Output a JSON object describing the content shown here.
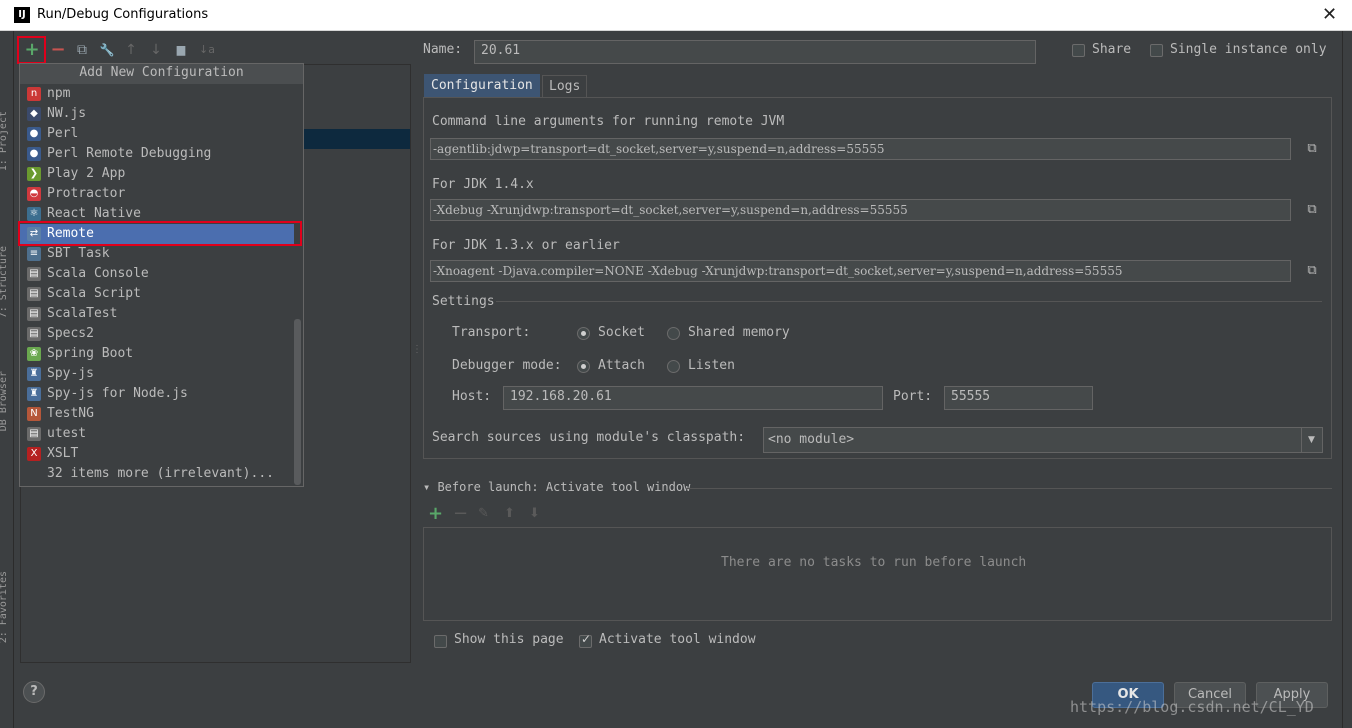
{
  "window": {
    "title": "Run/Debug Configurations",
    "app_badge": "IJ",
    "close_glyph": "✕"
  },
  "left_strip": [
    "1: Project",
    "7: Structure",
    "DB Browser",
    "2: Favorites"
  ],
  "toolbar": {
    "add": "+",
    "remove": "−",
    "copy": "⧉",
    "edit_defaults": "🔧",
    "move_up": "↑",
    "move_down": "↓",
    "folder": "▆",
    "sort": "↓a"
  },
  "popup": {
    "header": "Add New Configuration",
    "items": [
      {
        "label": "npm",
        "icon": "npm-icon",
        "color": "#cb3837",
        "glyph": "n"
      },
      {
        "label": "NW.js",
        "icon": "nwjs-icon",
        "color": "#3b4a6b",
        "glyph": "◆"
      },
      {
        "label": "Perl",
        "icon": "perl-icon",
        "color": "#3a5a8c",
        "glyph": "●"
      },
      {
        "label": "Perl Remote Debugging",
        "icon": "perl-icon",
        "color": "#3a5a8c",
        "glyph": "●"
      },
      {
        "label": "Play 2 App",
        "icon": "play-icon",
        "color": "#6a9a2f",
        "glyph": "❯"
      },
      {
        "label": "Protractor",
        "icon": "protractor-icon",
        "color": "#d0393e",
        "glyph": "◓"
      },
      {
        "label": "React Native",
        "icon": "react-icon",
        "color": "#3c6e8f",
        "glyph": "⚛"
      },
      {
        "label": "Remote",
        "icon": "remote-icon",
        "color": "#5b7fa6",
        "glyph": "⇄"
      },
      {
        "label": "SBT Task",
        "icon": "sbt-icon",
        "color": "#4e6f8d",
        "glyph": "≡"
      },
      {
        "label": "Scala Console",
        "icon": "scala-console-icon",
        "color": "#6b6b6b",
        "glyph": "▤"
      },
      {
        "label": "Scala Script",
        "icon": "scala-script-icon",
        "color": "#6b6b6b",
        "glyph": "▤"
      },
      {
        "label": "ScalaTest",
        "icon": "scalatest-icon",
        "color": "#6b6b6b",
        "glyph": "▤"
      },
      {
        "label": "Specs2",
        "icon": "specs2-icon",
        "color": "#6b6b6b",
        "glyph": "▤"
      },
      {
        "label": "Spring Boot",
        "icon": "spring-boot-icon",
        "color": "#6aa84f",
        "glyph": "❀"
      },
      {
        "label": "Spy-js",
        "icon": "spyjs-icon",
        "color": "#4a6e9a",
        "glyph": "♜"
      },
      {
        "label": "Spy-js for Node.js",
        "icon": "spyjs-node-icon",
        "color": "#4a6e9a",
        "glyph": "♜"
      },
      {
        "label": "TestNG",
        "icon": "testng-icon",
        "color": "#b5573a",
        "glyph": "N"
      },
      {
        "label": "utest",
        "icon": "utest-icon",
        "color": "#6b6b6b",
        "glyph": "▤"
      },
      {
        "label": "XSLT",
        "icon": "xslt-icon",
        "color": "#b52020",
        "glyph": "X"
      },
      {
        "label": "32 items more (irrelevant)...",
        "icon": "",
        "color": "",
        "glyph": ""
      }
    ],
    "selected_index": 7
  },
  "header": {
    "name_label": "Name:",
    "name_value": "20.61",
    "share_label": "Share",
    "share_checked": false,
    "single_label": "Single instance only",
    "single_checked": false
  },
  "tabs": [
    {
      "label": "Configuration",
      "active": true
    },
    {
      "label": "Logs",
      "active": false
    }
  ],
  "config": {
    "cmd_label": "Command line arguments for running remote JVM",
    "cmd_value": "-agentlib:jdwp=transport=dt_socket,server=y,suspend=n,address=55555",
    "jdk14_label": "For JDK 1.4.x",
    "jdk14_value": "-Xdebug -Xrunjdwp:transport=dt_socket,server=y,suspend=n,address=55555",
    "jdk13_label": "For JDK 1.3.x or earlier",
    "jdk13_value": "-Xnoagent -Djava.compiler=NONE -Xdebug -Xrunjdwp:transport=dt_socket,server=y,suspend=n,address=55555",
    "settings_label": "Settings",
    "transport_label": "Transport:",
    "transport_socket": "Socket",
    "transport_shared": "Shared memory",
    "transport_selected": "Socket",
    "debugger_label": "Debugger mode:",
    "debugger_attach": "Attach",
    "debugger_listen": "Listen",
    "debugger_selected": "Attach",
    "host_label": "Host:",
    "host_value": "192.168.20.61",
    "port_label": "Port:",
    "port_value": "55555",
    "module_label": "Search sources using module's classpath:",
    "module_value": "<no module>"
  },
  "before_launch": {
    "title": "Before launch: Activate tool window",
    "empty_text": "There are no tasks to run before launch",
    "show_page_label": "Show this page",
    "show_page_checked": false,
    "activate_label": "Activate tool window",
    "activate_checked": true
  },
  "buttons": {
    "ok": "OK",
    "cancel": "Cancel",
    "apply": "Apply",
    "help": "?"
  },
  "watermark": "https://blog.csdn.net/CL_YD",
  "colors": {
    "accent": "#4b6eaf",
    "highlight_box": "#e0001b",
    "add_green": "#59a869",
    "remove_red": "#c75450"
  }
}
